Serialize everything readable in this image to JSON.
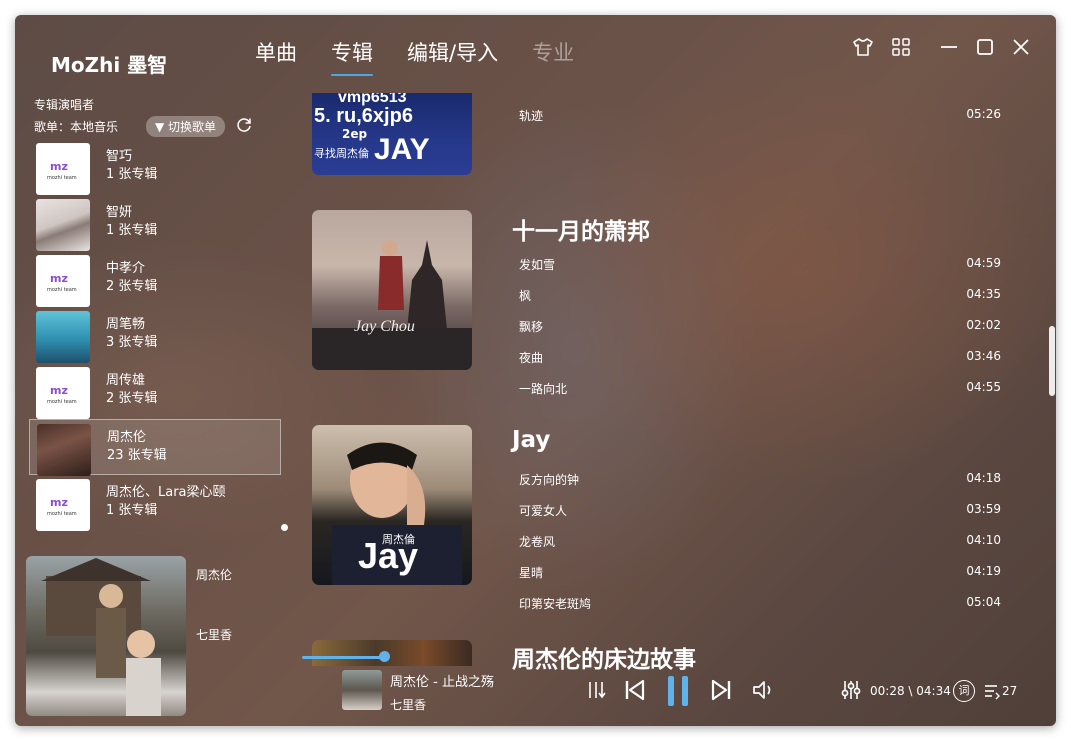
{
  "app": {
    "brand": "MoZhi 墨智"
  },
  "tabs": [
    {
      "label": "单曲",
      "state": "normal"
    },
    {
      "label": "专辑",
      "state": "active"
    },
    {
      "label": "编辑/导入",
      "state": "normal"
    },
    {
      "label": "专业",
      "state": "disabled"
    }
  ],
  "window_controls": [
    "shirt-icon",
    "grid-icon",
    "minimize-icon",
    "maximize-icon",
    "close-icon"
  ],
  "sidebar": {
    "section_title": "专辑演唱者",
    "playlist_label": "歌单：本地音乐",
    "switch_label": "▼ 切换歌单",
    "artists": [
      {
        "name": "智巧",
        "count": "1 张专辑",
        "thumb": "mozhi-logo"
      },
      {
        "name": "智妍",
        "count": "1 张专辑",
        "thumb": "photo"
      },
      {
        "name": "中孝介",
        "count": "2 张专辑",
        "thumb": "mozhi-logo"
      },
      {
        "name": "周笔畅",
        "count": "3 张专辑",
        "thumb": "photo"
      },
      {
        "name": "周传雄",
        "count": "2 张专辑",
        "thumb": "mozhi-logo"
      },
      {
        "name": "周杰伦",
        "count": "23 张专辑",
        "thumb": "photo",
        "selected": true
      },
      {
        "name": "周杰伦、Lara梁心颐",
        "count": "1 张专辑",
        "thumb": "mozhi-logo"
      }
    ],
    "logo_text": "mz",
    "logo_sub": "mozhi team"
  },
  "now_playing_panel": {
    "artist": "周杰伦",
    "album": "七里香"
  },
  "albums": [
    {
      "title": "",
      "cover_text": [
        "vmp6513",
        "5. ru,6xjp6",
        "2ep",
        "寻找周杰倫",
        "JAY"
      ],
      "tracks": [
        {
          "name": "轨迹",
          "duration": "05:26"
        }
      ]
    },
    {
      "title": "十一月的萧邦",
      "cover_text": [
        "Jay Chou"
      ],
      "tracks": [
        {
          "name": "发如雪",
          "duration": "04:59"
        },
        {
          "name": "枫",
          "duration": "04:35"
        },
        {
          "name": "飘移",
          "duration": "02:02"
        },
        {
          "name": "夜曲",
          "duration": "03:46"
        },
        {
          "name": "一路向北",
          "duration": "04:55"
        }
      ]
    },
    {
      "title": "Jay",
      "cover_text": [
        "周杰倫",
        "Jay"
      ],
      "tracks": [
        {
          "name": "反方向的钟",
          "duration": "04:18"
        },
        {
          "name": "可爱女人",
          "duration": "03:59"
        },
        {
          "name": "龙卷风",
          "duration": "04:10"
        },
        {
          "name": "星晴",
          "duration": "04:19"
        },
        {
          "name": "印第安老斑鸠",
          "duration": "05:04"
        }
      ]
    },
    {
      "title": "周杰伦的床边故事",
      "cover_text": [],
      "tracks": []
    }
  ],
  "player": {
    "song_title": "周杰伦 - 止战之殇",
    "song_album": "七里香",
    "time": "00:28 \\ 04:34",
    "lyrics_label": "词",
    "queue_count": "27",
    "progress": 0.1,
    "accent": "#5fb2ea"
  }
}
